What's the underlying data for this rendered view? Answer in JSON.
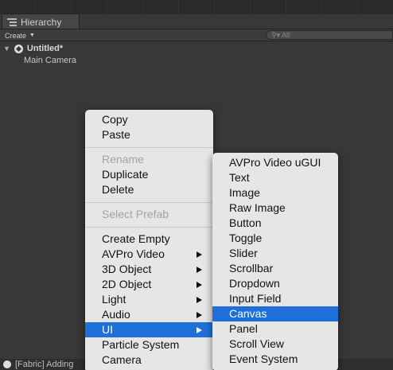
{
  "tab": {
    "title": "Hierarchy"
  },
  "toolbar": {
    "create_label": "Create",
    "search_placeholder": "All"
  },
  "scene": {
    "name": "Untitled*",
    "objects": [
      "Main Camera"
    ]
  },
  "status": {
    "text": "[Fabric] Adding"
  },
  "context_menu": {
    "groups": [
      [
        {
          "label": "Copy"
        },
        {
          "label": "Paste"
        }
      ],
      [
        {
          "label": "Rename",
          "disabled": true
        },
        {
          "label": "Duplicate"
        },
        {
          "label": "Delete"
        }
      ],
      [
        {
          "label": "Select Prefab",
          "disabled": true
        }
      ],
      [
        {
          "label": "Create Empty"
        },
        {
          "label": "AVPro Video",
          "submenu": true
        },
        {
          "label": "3D Object",
          "submenu": true
        },
        {
          "label": "2D Object",
          "submenu": true
        },
        {
          "label": "Light",
          "submenu": true
        },
        {
          "label": "Audio",
          "submenu": true
        },
        {
          "label": "UI",
          "submenu": true,
          "active": true
        },
        {
          "label": "Particle System"
        },
        {
          "label": "Camera"
        }
      ]
    ]
  },
  "ui_submenu": {
    "items": [
      {
        "label": "AVPro Video uGUI"
      },
      {
        "label": "Text"
      },
      {
        "label": "Image"
      },
      {
        "label": "Raw Image"
      },
      {
        "label": "Button"
      },
      {
        "label": "Toggle"
      },
      {
        "label": "Slider"
      },
      {
        "label": "Scrollbar"
      },
      {
        "label": "Dropdown"
      },
      {
        "label": "Input Field"
      },
      {
        "label": "Canvas",
        "active": true
      },
      {
        "label": "Panel"
      },
      {
        "label": "Scroll View"
      },
      {
        "label": "Event System"
      }
    ]
  },
  "colors": {
    "highlight": "#1f6fd9",
    "menu_bg": "#e6e6e6",
    "editor_bg": "#383838"
  }
}
